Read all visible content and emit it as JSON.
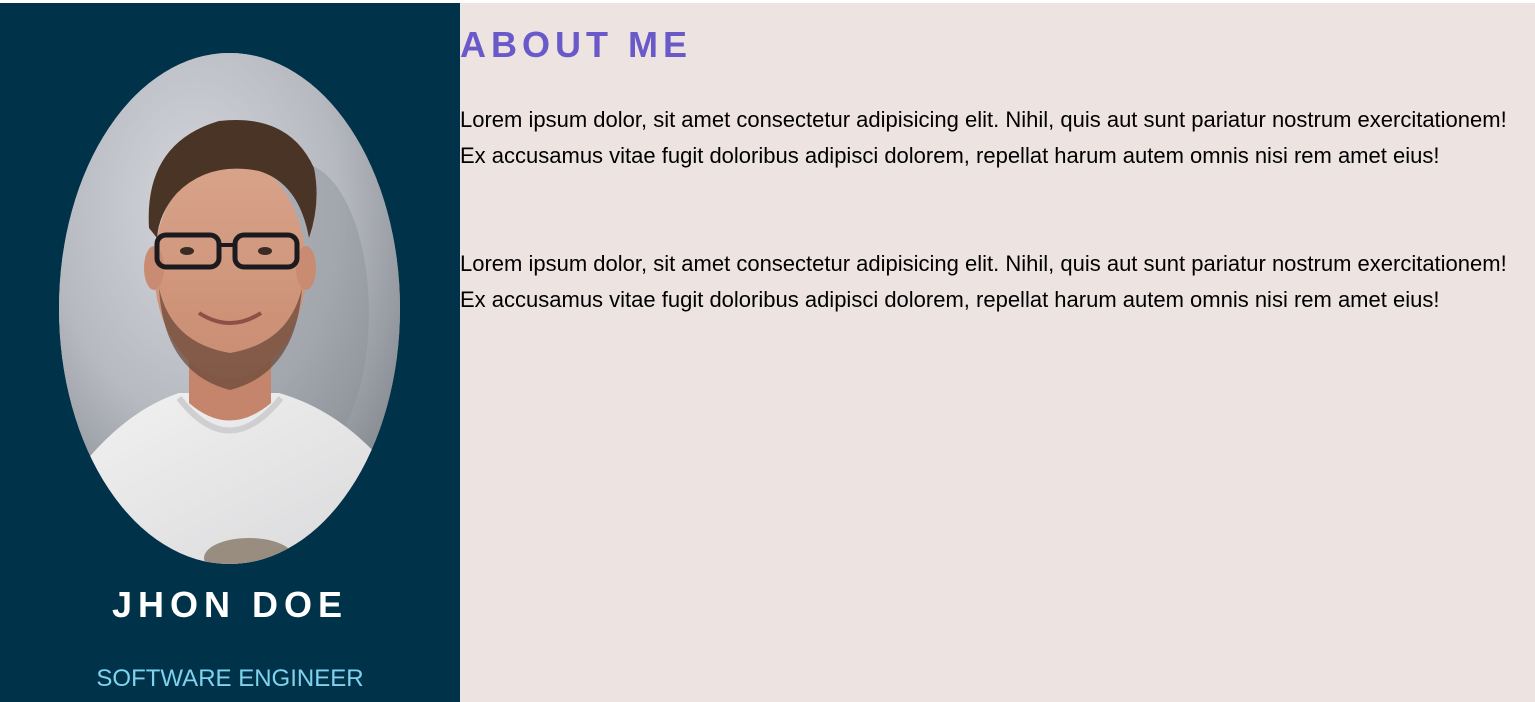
{
  "profile": {
    "name": "JHON DOE",
    "role": "SOFTWARE ENGINEER",
    "colors": {
      "sidebar_bg": "#00334a",
      "name": "#ffffff",
      "role": "#7fd3ee"
    }
  },
  "about": {
    "title": "ABOUT ME",
    "paragraphs": [
      "Lorem ipsum dolor, sit amet consectetur adipisicing elit. Nihil, quis aut sunt pariatur nostrum exercitationem! Ex accusamus vitae fugit doloribus adipisci dolorem, repellat harum autem omnis nisi rem amet eius!",
      "Lorem ipsum dolor, sit amet consectetur adipisicing elit. Nihil, quis aut sunt pariatur nostrum exercitationem! Ex accusamus vitae fugit doloribus adipisci dolorem, repellat harum autem omnis nisi rem amet eius!"
    ],
    "colors": {
      "main_bg": "#ede4e2",
      "title": "#6a59c9",
      "text": "#000000"
    }
  }
}
